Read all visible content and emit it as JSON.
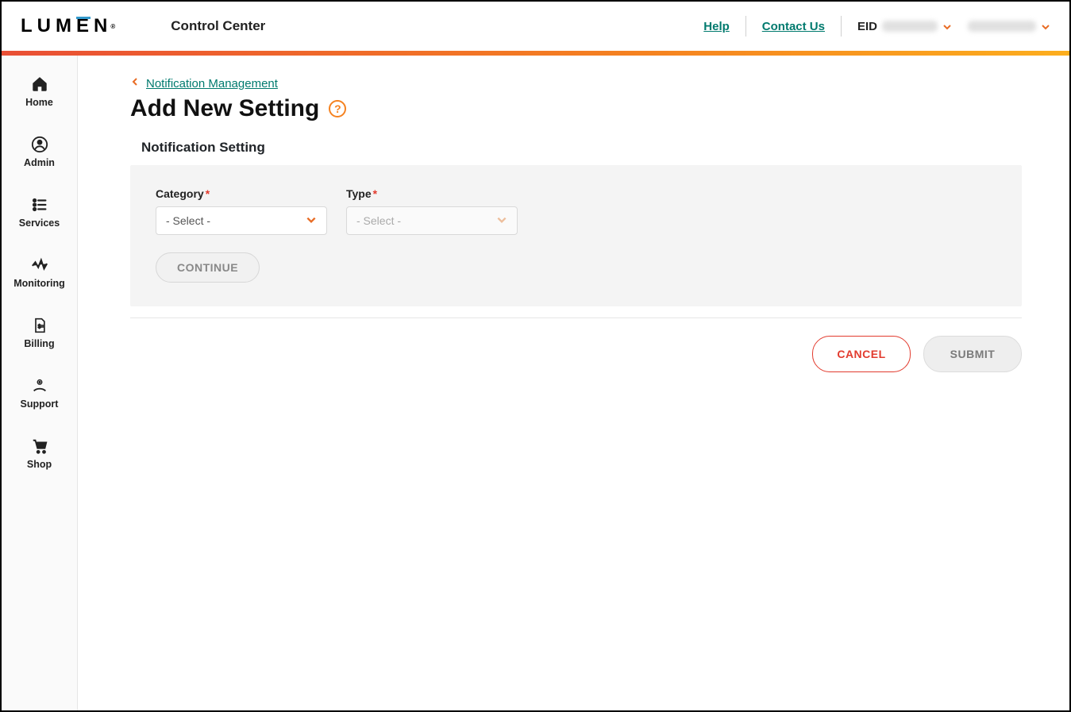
{
  "header": {
    "logo_text": "LUMEN",
    "app_title": "Control Center",
    "help_label": "Help",
    "contact_label": "Contact Us",
    "eid_label": "EID"
  },
  "sidebar": {
    "items": [
      {
        "label": "Home"
      },
      {
        "label": "Admin"
      },
      {
        "label": "Services"
      },
      {
        "label": "Monitoring"
      },
      {
        "label": "Billing"
      },
      {
        "label": "Support"
      },
      {
        "label": "Shop"
      }
    ]
  },
  "breadcrumb": {
    "parent_label": "Notification Management"
  },
  "page": {
    "title": "Add New Setting",
    "section_title": "Notification Setting"
  },
  "form": {
    "category_label": "Category",
    "category_placeholder": "- Select -",
    "type_label": "Type",
    "type_placeholder": "- Select -",
    "continue_label": "CONTINUE"
  },
  "actions": {
    "cancel_label": "CANCEL",
    "submit_label": "SUBMIT"
  }
}
